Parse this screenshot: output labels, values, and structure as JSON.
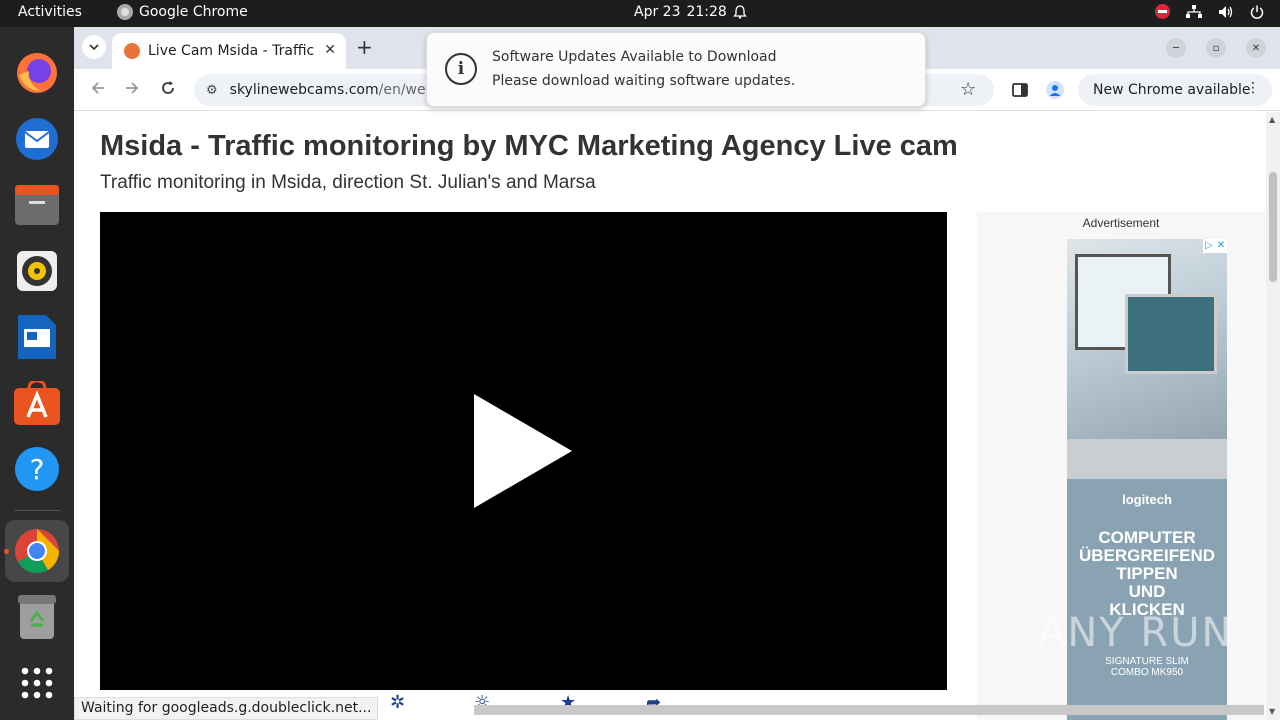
{
  "topbar": {
    "activities": "Activities",
    "app_name": "Google Chrome",
    "date": "Apr 23",
    "time": "21:28"
  },
  "dock": {
    "items": [
      "firefox-icon",
      "thunderbird-icon",
      "files-icon",
      "rhythmbox-icon",
      "writer-icon",
      "app-center-icon",
      "help-icon",
      "chrome-icon",
      "trash-icon",
      "app-grid-icon"
    ]
  },
  "browser": {
    "tab_title": "Live Cam Msida - Traffic monitoring",
    "url_host": "skylinewebcams.com",
    "url_path": "/en/webca",
    "new_chrome": "New Chrome available"
  },
  "notification": {
    "title": "Software Updates Available to Download",
    "body": "Please download waiting software updates."
  },
  "page": {
    "heading": "Msida - Traffic monitoring by MYC Marketing Agency Live cam",
    "subheading": "Traffic monitoring in Msida, direction St. Julian's and Marsa"
  },
  "ad": {
    "label": "Advertisement",
    "brand": "logitech",
    "headline_1": "COMPUTER",
    "headline_2": "ÜBERGREIFEND",
    "headline_3": "TIPPEN",
    "headline_4": "UND",
    "headline_5": "KLICKEN",
    "product_1": "SIGNATURE SLIM",
    "product_2": "COMBO MK950"
  },
  "status": "Waiting for googleads.g.doubleclick.net...",
  "watermark": "ANY RUN",
  "colors": {
    "topbar_bg": "#1d1d1d",
    "dock_bg": "#2b2b2b",
    "tabstrip_bg": "#dfe3eb",
    "accent_orange": "#e95420",
    "control_blue": "#1b3f8b"
  }
}
